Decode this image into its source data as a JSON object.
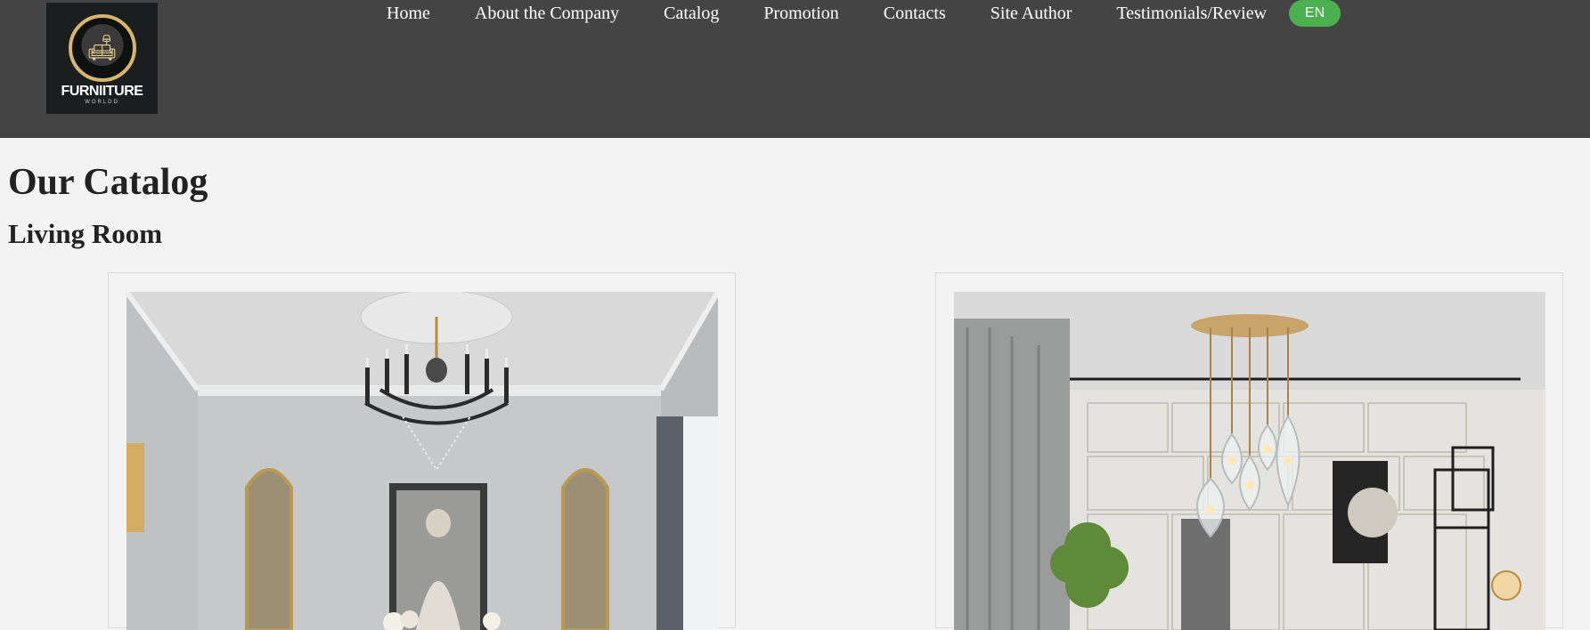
{
  "brand": {
    "name": "FURNIITURE",
    "tagline": "WORLDD",
    "logo_icon": "sofa-icon"
  },
  "nav": {
    "items": [
      {
        "label": "Home"
      },
      {
        "label": "About the Company"
      },
      {
        "label": "Catalog"
      },
      {
        "label": "Promotion"
      },
      {
        "label": "Contacts"
      },
      {
        "label": "Site Author"
      },
      {
        "label": "Testimonials/Review"
      }
    ],
    "language": "EN"
  },
  "colors": {
    "header_bg": "#444444",
    "page_bg": "#f3f3f3",
    "language_button": "#4caf50"
  },
  "main": {
    "title": "Our Catalog",
    "section": "Living Room",
    "products": [
      {
        "image": "classic-living-room-with-chandelier-photo"
      },
      {
        "image": "modern-living-room-with-pendant-lights-photo"
      }
    ]
  }
}
